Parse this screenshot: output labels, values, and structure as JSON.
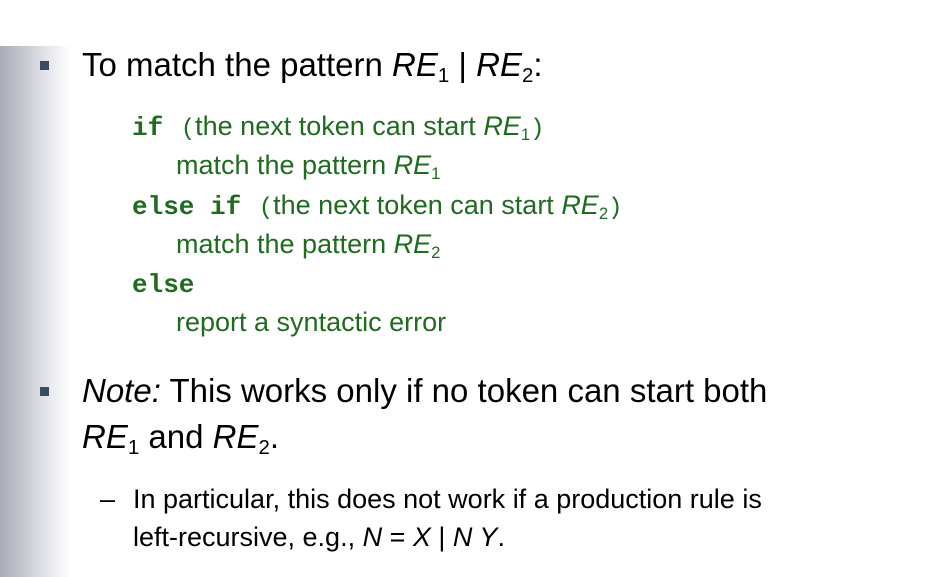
{
  "bullet1": {
    "lead": "To match the pattern ",
    "re": "RE",
    "sub1": "1",
    "sep": " | ",
    "sub2": "2",
    "end": ":"
  },
  "code": {
    "if": "if",
    "open_paren": "(",
    "close_paren": ")",
    "cond_text": "the next token can start ",
    "re": "RE",
    "sub1": "1",
    "sub2": "2",
    "match_text": "match the pattern ",
    "else_if": "else if",
    "else": "else",
    "error_text": "report a syntactic error"
  },
  "bullet2": {
    "note_label": "Note:",
    "text": " This works only if no token can start both",
    "re": "RE",
    "sub1": "1",
    "and_text": " and ",
    "sub2": "2",
    "end": "."
  },
  "sub_point": {
    "dash": "–",
    "line1": "In particular, this does not work if a production rule is",
    "line2_lead": "left-recursive, e.g., ",
    "n": "N",
    "eq": " = ",
    "x": "X",
    "bar": " | ",
    "ny": "N Y",
    "end": "."
  }
}
